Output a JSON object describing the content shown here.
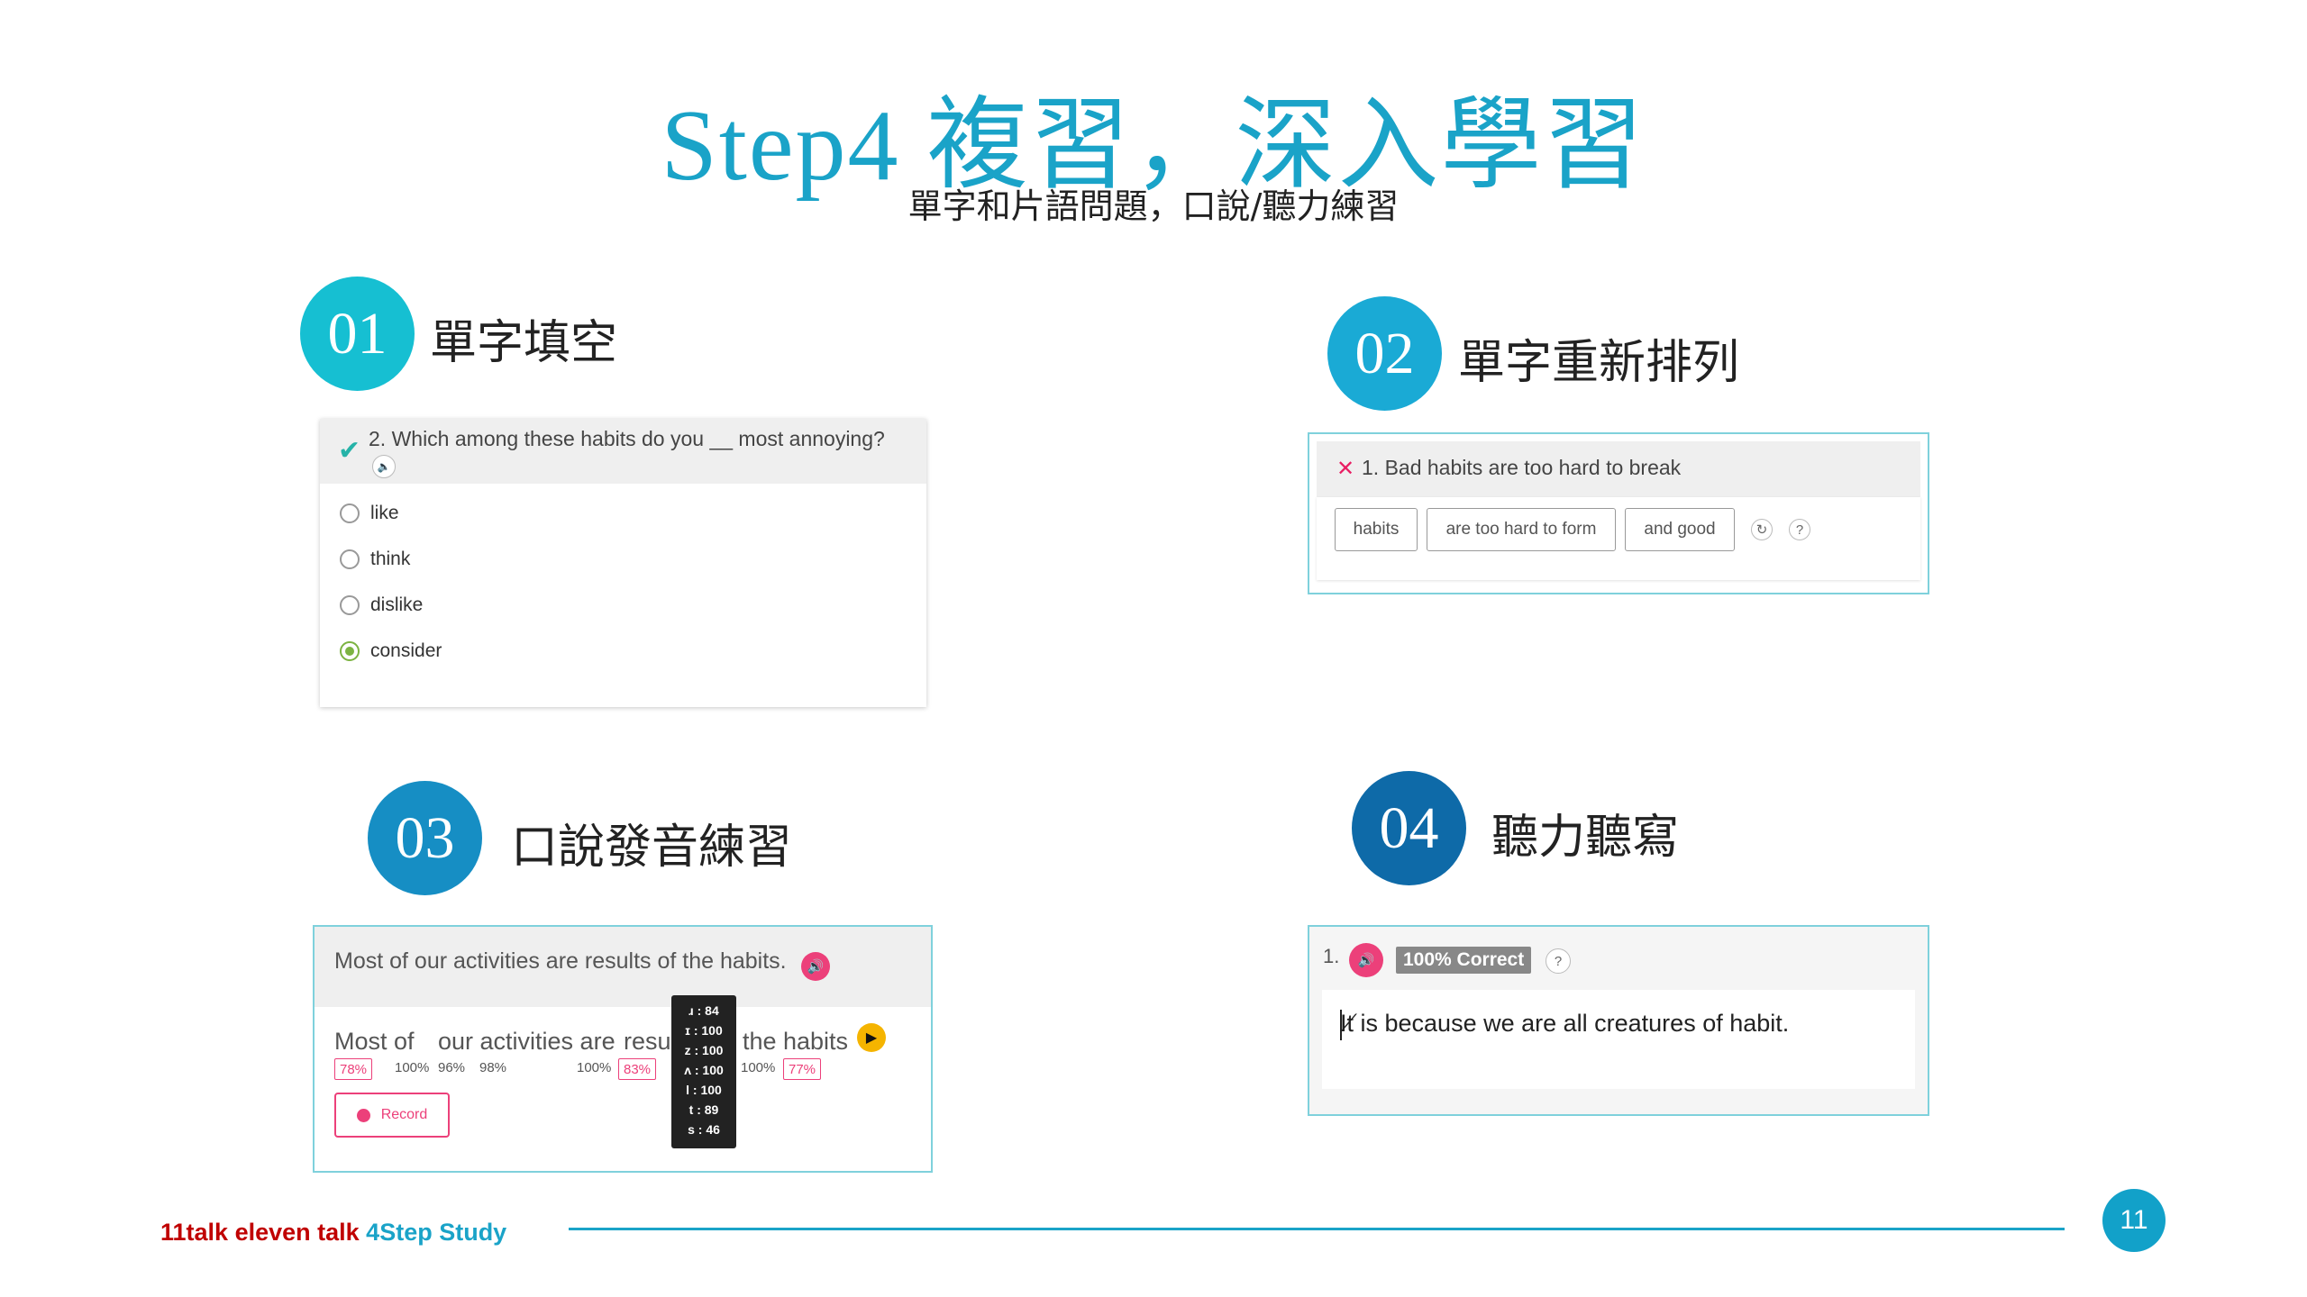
{
  "title": "Step4 複習，深入學習",
  "subtitle": "單字和片語問題，口說/聽力練習",
  "colors": {
    "title": "#1aa3c8",
    "step1": "#16bfd2",
    "step2": "#1aaad5",
    "step3": "#168ec4",
    "step4": "#0e6aa8",
    "accent_pink": "#ec407a",
    "correct_green": "#7cb342",
    "brand_red": "#c00000"
  },
  "steps": [
    {
      "number": "01",
      "label": "單字填空"
    },
    {
      "number": "02",
      "label": "單字重新排列"
    },
    {
      "number": "03",
      "label": "口說發音練習"
    },
    {
      "number": "04",
      "label": "聽力聽寫"
    }
  ],
  "fill_blank": {
    "question": "2. Which among these habits do you __ most annoying?",
    "status_icon": "check-icon",
    "options": [
      {
        "label": "like",
        "selected": false
      },
      {
        "label": "think",
        "selected": false
      },
      {
        "label": "dislike",
        "selected": false
      },
      {
        "label": "consider",
        "selected": true
      }
    ]
  },
  "rearrange": {
    "status_icon": "cross-icon",
    "question": "1. Bad habits are too hard to break",
    "chips": [
      "habits",
      "are too hard to form",
      "and good"
    ],
    "help": "?"
  },
  "speaking": {
    "sentence": "Most of our activities are results of the habits.",
    "words": [
      "Most of",
      "our activities are",
      "resul",
      "the",
      "habits"
    ],
    "scores": [
      "78%",
      "100%",
      "96%",
      "98%",
      "100%",
      "83%",
      "100%",
      "77%"
    ],
    "phoneme_scores": [
      "ɹ : 84",
      "ɪ : 100",
      "z : 100",
      "ʌ : 100",
      "l : 100",
      "t : 89",
      "s : 46"
    ],
    "record_label": "Record"
  },
  "dictation": {
    "number": "1.",
    "badge": "100% Correct",
    "help": "?",
    "answer": "It is because we are all  creatures of habit."
  },
  "footer": {
    "brand": "11talk eleven talk",
    "study": "4Step Study",
    "page": "11"
  }
}
